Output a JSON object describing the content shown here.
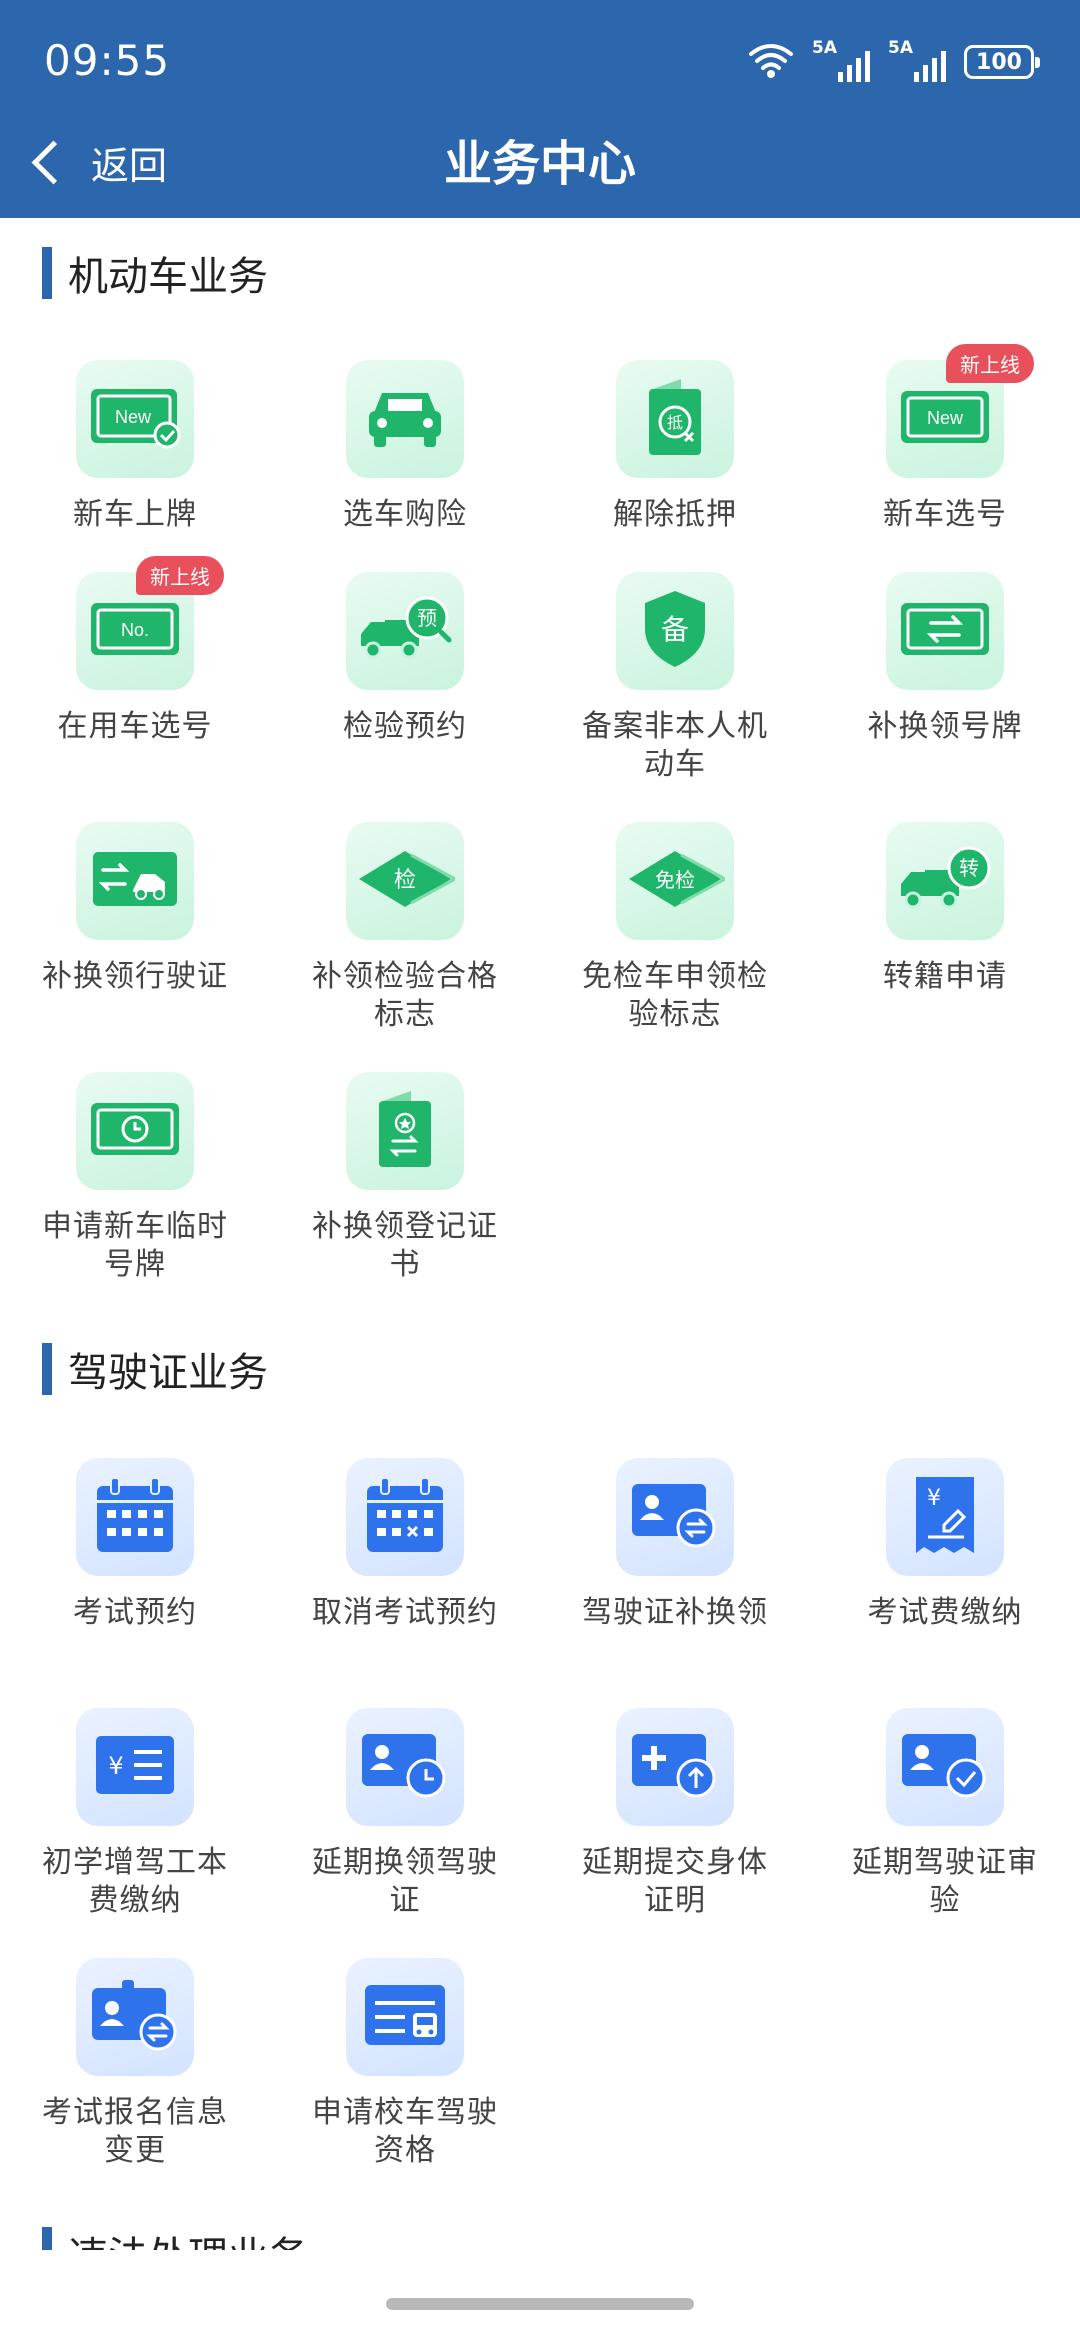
{
  "status_bar": {
    "time": "09:55",
    "signal_1": "5A",
    "signal_2": "5A",
    "battery": "100"
  },
  "header": {
    "back_label": "返回",
    "title": "业务中心"
  },
  "colors": {
    "header_bg": "#2c67ae",
    "green_icon": "#1fb56a",
    "blue_icon": "#2f73ec",
    "badge": "#e8505b"
  },
  "sections": [
    {
      "title": "机动车业务",
      "items": [
        {
          "label": "新车上牌",
          "icon": "new-plate-check-icon",
          "badge": ""
        },
        {
          "label": "选车购险",
          "icon": "car-icon",
          "badge": ""
        },
        {
          "label": "解除抵押",
          "icon": "mortgage-release-icon",
          "badge": ""
        },
        {
          "label": "新车选号",
          "icon": "new-plate-icon",
          "badge": "新上线"
        },
        {
          "label": "在用车选号",
          "icon": "number-plate-icon",
          "badge": "新上线"
        },
        {
          "label": "检验预约",
          "icon": "inspection-truck-icon",
          "badge": ""
        },
        {
          "label": "备案非本人机动车",
          "icon": "record-shield-icon",
          "badge": ""
        },
        {
          "label": "补换领号牌",
          "icon": "plate-exchange-icon",
          "badge": ""
        },
        {
          "label": "补换领行驶证",
          "icon": "license-exchange-icon",
          "badge": ""
        },
        {
          "label": "补领检验合格标志",
          "icon": "inspection-sign-icon",
          "badge": ""
        },
        {
          "label": "免检车申领检验标志",
          "icon": "exempt-sign-icon",
          "badge": ""
        },
        {
          "label": "转籍申请",
          "icon": "transfer-truck-icon",
          "badge": ""
        },
        {
          "label": "申请新车临时号牌",
          "icon": "temp-plate-clock-icon",
          "badge": ""
        },
        {
          "label": "补换领登记证书",
          "icon": "registration-book-icon",
          "badge": ""
        }
      ]
    },
    {
      "title": "驾驶证业务",
      "items": [
        {
          "label": "考试预约",
          "icon": "calendar-icon",
          "badge": ""
        },
        {
          "label": "取消考试预约",
          "icon": "calendar-cancel-icon",
          "badge": ""
        },
        {
          "label": "驾驶证补换领",
          "icon": "id-card-exchange-icon",
          "badge": ""
        },
        {
          "label": "考试费缴纳",
          "icon": "fee-receipt-icon",
          "badge": ""
        },
        {
          "label": "初学增驾工本费缴纳",
          "icon": "fee-list-icon",
          "badge": ""
        },
        {
          "label": "延期换领驾驶证",
          "icon": "id-card-clock-icon",
          "badge": ""
        },
        {
          "label": "延期提交身体证明",
          "icon": "medical-upload-icon",
          "badge": ""
        },
        {
          "label": "延期驾驶证审验",
          "icon": "id-card-check-icon",
          "badge": ""
        },
        {
          "label": "考试报名信息变更",
          "icon": "badge-exchange-icon",
          "badge": ""
        },
        {
          "label": "申请校车驾驶资格",
          "icon": "school-bus-icon",
          "badge": ""
        }
      ]
    },
    {
      "title": "违法处理业务",
      "items": []
    }
  ]
}
